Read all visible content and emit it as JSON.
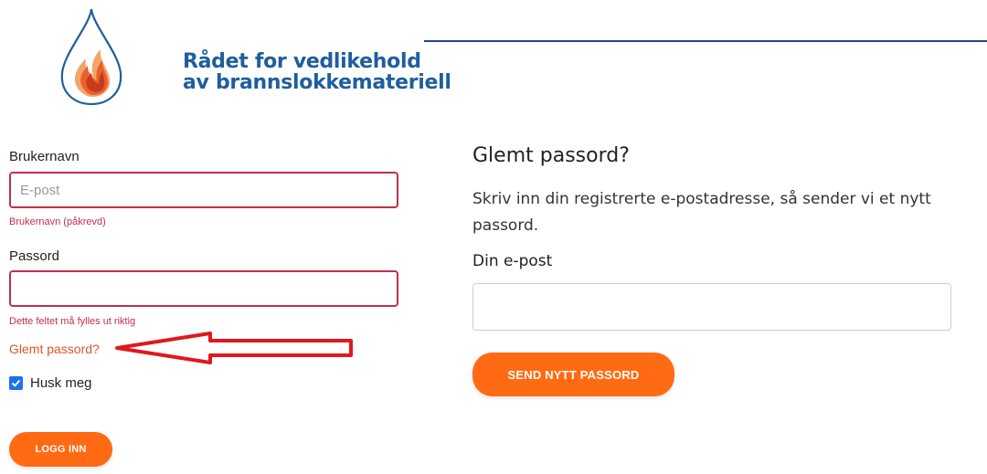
{
  "logo": {
    "line1": "Rådet for vedlikehold",
    "line2": "av brannslokkemateriell"
  },
  "login": {
    "username_label": "Brukernavn",
    "username_placeholder": "E-post",
    "username_error": "Brukernavn (påkrevd)",
    "password_label": "Passord",
    "password_error": "Dette feltet må fylles ut riktig",
    "forgot_link": "Glemt passord?",
    "remember_label": "Husk meg",
    "remember_checked": true,
    "login_button": "LOGG INN"
  },
  "forgot": {
    "title": "Glemt passord?",
    "description": "Skriv inn din registrerte e-postadresse, så sender vi et nytt passord.",
    "email_label": "Din e-post",
    "send_button": "SEND NYTT PASSORD"
  },
  "colors": {
    "brand_blue": "#1f5e9e",
    "accent_orange": "#ff6a13",
    "error_red": "#c0304a",
    "link_orange": "#e0552a",
    "annotation_arrow": "#e0191e"
  }
}
